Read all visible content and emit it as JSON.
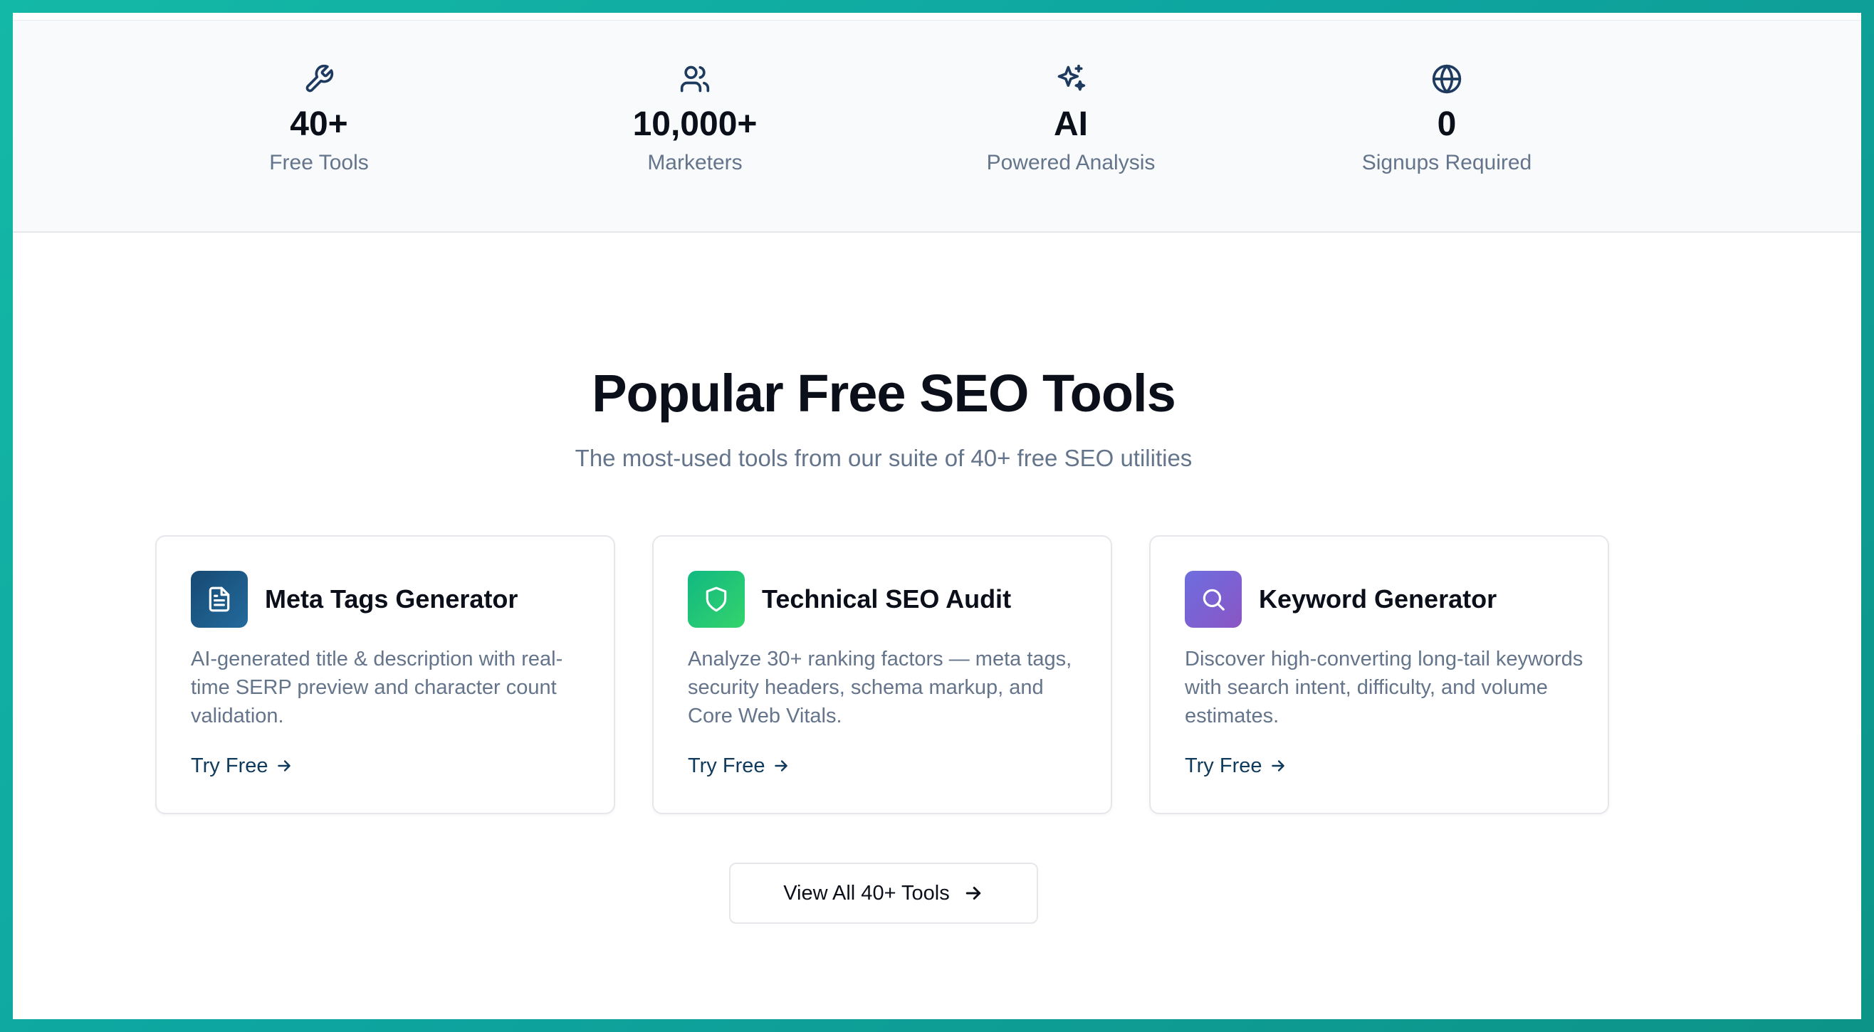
{
  "stats": [
    {
      "value": "40+",
      "label": "Free Tools",
      "icon": "wrench-icon"
    },
    {
      "value": "10,000+",
      "label": "Marketers",
      "icon": "users-icon"
    },
    {
      "value": "AI",
      "label": "Powered Analysis",
      "icon": "sparkles-icon"
    },
    {
      "value": "0",
      "label": "Signups Required",
      "icon": "globe-icon"
    }
  ],
  "tools_section": {
    "heading": "Popular Free SEO Tools",
    "subheading": "The most-used tools from our suite of 40+ free SEO utilities",
    "cards": [
      {
        "title": "Meta Tags Generator",
        "description": "AI-generated title & description with real-time SERP preview and character count validation.",
        "cta": "Try Free",
        "icon": "document-icon",
        "color": "#1e5a8a"
      },
      {
        "title": "Technical SEO Audit",
        "description": "Analyze 30+ ranking factors — meta tags, security headers, schema markup, and Core Web Vitals.",
        "cta": "Try Free",
        "icon": "shield-icon",
        "color": "#22c55e"
      },
      {
        "title": "Keyword Generator",
        "description": "Discover high-converting long-tail keywords with search intent, difficulty, and volume estimates.",
        "cta": "Try Free",
        "icon": "search-icon",
        "color": "#7c5fd6"
      }
    ],
    "view_all_label": "View All 40+ Tools"
  },
  "theme": {
    "accent_dark": "#0f3a5c",
    "frame_gradient": "#14b8a6"
  }
}
